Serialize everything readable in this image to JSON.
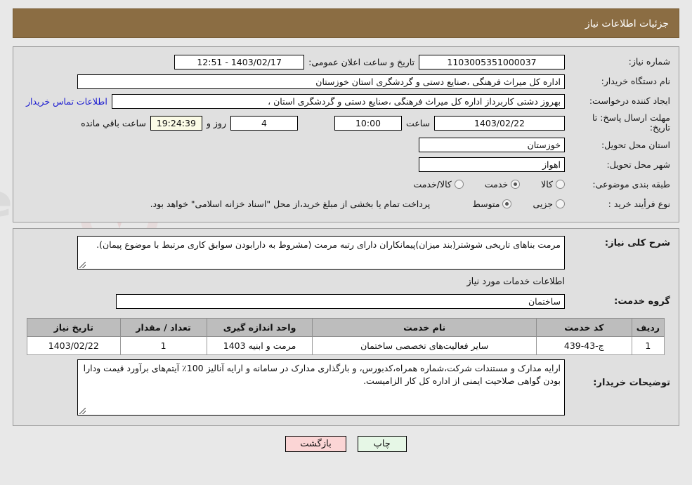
{
  "header": {
    "title": "جزئیات اطلاعات نیاز",
    "bg_color": "#8b6d43",
    "text_color": "#ffffff"
  },
  "form": {
    "need_number_label": "شماره نیاز:",
    "need_number_value": "1103005351000037",
    "announce_datetime_label": "تاریخ و ساعت اعلان عمومی:",
    "announce_datetime_value": "1403/02/17 - 12:51",
    "buyer_org_label": "نام دستگاه خریدار:",
    "buyer_org_value": "اداره کل میراث فرهنگی ،صنایع دستی و گردشگری استان خوزستان",
    "creator_label": "ایجاد کننده درخواست:",
    "creator_value": "بهروز دشتی کاربرداز اداره کل میراث فرهنگی ،صنایع دستی و گردشگری استان ،",
    "contact_link": "اطلاعات تماس خریدار",
    "deadline_label": "مهلت ارسال پاسخ: تا تاریخ:",
    "deadline_date": "1403/02/22",
    "deadline_hour_label": "ساعت",
    "deadline_hour_value": "10:00",
    "remaining_days_value": "4",
    "remaining_days_label": "روز و",
    "remaining_countdown": "19:24:39",
    "remaining_suffix": "ساعت باقي مانده",
    "province_label": "استان محل تحویل:",
    "province_value": "خوزستان",
    "city_label": "شهر محل تحویل:",
    "city_value": "اهواز",
    "category_label": "طبقه بندی موضوعی:",
    "category_options": [
      {
        "label": "کالا",
        "selected": false
      },
      {
        "label": "خدمت",
        "selected": true
      },
      {
        "label": "کالا/خدمت",
        "selected": false
      }
    ],
    "process_label": "نوع فرأیند خرید :",
    "process_options": [
      {
        "label": "جزیی",
        "selected": false
      },
      {
        "label": "متوسط",
        "selected": true
      }
    ],
    "process_note": "پرداخت تمام یا بخشی از مبلغ خرید،از محل \"اسناد خزانه اسلامی\" خواهد بود."
  },
  "description": {
    "need_summary_label": "شرح کلی نیاز:",
    "need_summary_value": "مرمت بناهای تاریخی شوشتر(بند میزان)پیمانکاران دارای رتبه مرمت (مشروط به دارابودن سوابق کاری مرتبط با موضوع پیمان).",
    "services_section_title": "اطلاعات خدمات مورد نیاز",
    "service_group_label": "گروه خدمت:",
    "service_group_value": "ساختمان"
  },
  "table": {
    "columns": [
      "ردیف",
      "کد خدمت",
      "نام خدمت",
      "واحد اندازه گیری",
      "تعداد / مقدار",
      "تاریخ نیاز"
    ],
    "rows": [
      {
        "radif": "1",
        "code": "ج-43-439",
        "name": "سایر فعالیت‌های تخصصی ساختمان",
        "unit": "مرمت و ابنیه 1403",
        "qty": "1",
        "date": "1403/02/22"
      }
    ]
  },
  "buyer_notes": {
    "label": "توضیحات خریدار:",
    "value": "ارایه مدارک و مستندات شرکت،شماره همراه،کدبورس، و بارگذاری مدارک در سامانه و ارایه آنالیز 100٪ آیتم‌های برآورد قیمت ودارا بودن گواهی صلاحیت ایمنی از اداره کل کار الزامیست."
  },
  "footer": {
    "print_label": "چاپ",
    "back_label": "بازگشت",
    "print_color": "#e6f7e6",
    "back_color": "#fbd5d5"
  },
  "watermark": {
    "text": "AriaTender.net"
  }
}
